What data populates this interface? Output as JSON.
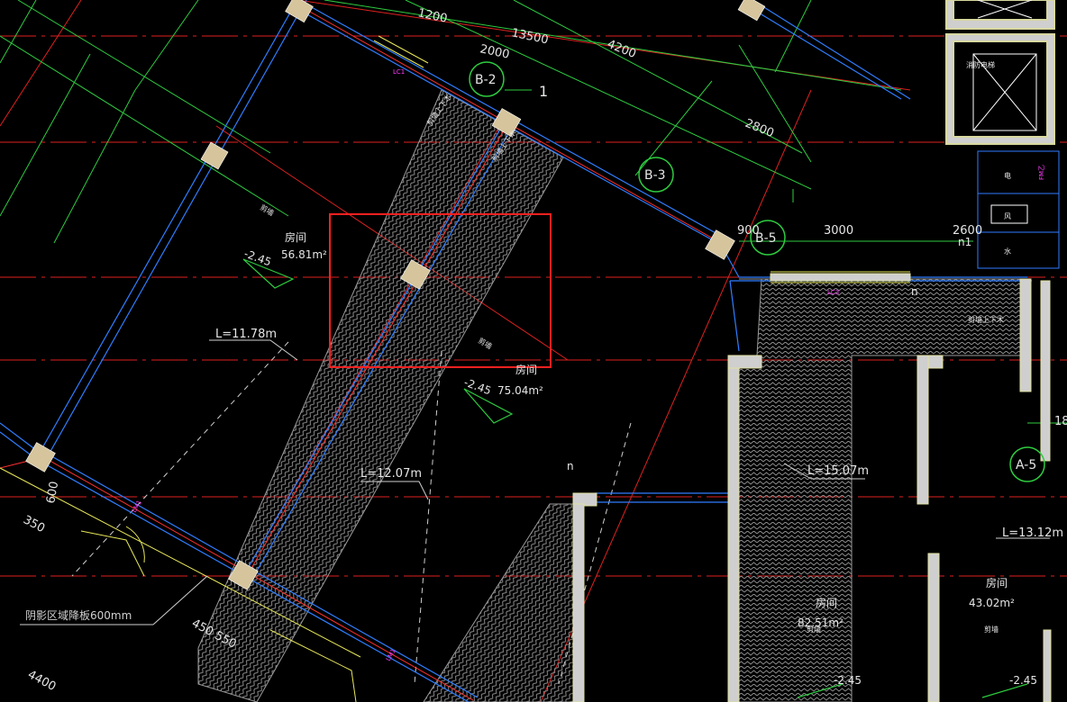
{
  "colors": {
    "background": "#000000",
    "axis": "#ff2a2a",
    "wall": "#2f7dff",
    "dim_green": "#2ecc40",
    "dim_text": "#e6e6e6",
    "column": "#d6c59c",
    "highlight": "#ff2020",
    "magenta": "#ff3cff",
    "hatch": "#9a9a9a",
    "yellow": "#ffff4a"
  },
  "grid_labels": {
    "b2": "B-2",
    "b3": "B-3",
    "b5": "B-5",
    "a5": "A-5",
    "one": "1"
  },
  "dimensions": {
    "d1200": "1200",
    "d13500": "13500",
    "d2000": "2000",
    "d4200": "4200",
    "d2800": "2800",
    "d900": "900",
    "d3000": "3000",
    "d2600": "2600",
    "d600": "600",
    "d350": "350",
    "d450550": "450 550",
    "d4400": "4400",
    "d18": "18"
  },
  "lengths": {
    "l1": "L=11.78m",
    "l2": "L=12.07m",
    "l3": "L=15.07m",
    "l4": "L=13.12m"
  },
  "rooms": {
    "r1_name": "房间",
    "r1_area": "56.81m²",
    "r2_name": "房间",
    "r2_area": "75.04m²",
    "r3_name": "房间",
    "r3_area": "82.51m²",
    "r4_name": "房间",
    "r4_area": "43.02m²"
  },
  "elevations": {
    "e1": "-2.45",
    "e2": "-2.45",
    "e3": "-2.45",
    "e4": "-2.45"
  },
  "small_labels": {
    "wall_a": "剪墙",
    "wall_b": "剪墙",
    "wall_c": "剪墙",
    "wall_d": "剪墙",
    "beam1": "剪墙上下木",
    "beam2": "剪墙上下木",
    "beam3": "剪墙上下木",
    "elevator": "消防电梯",
    "elec": "电",
    "wind": "风",
    "water": "水",
    "n1": "n1",
    "n_a": "n",
    "n_b": "n",
    "lc1": "LC1",
    "lc2": "LC3",
    "lm1": "LM1",
    "lm2": "LM1",
    "fire": "FM乙"
  },
  "note": "阴影区域降板600mm"
}
